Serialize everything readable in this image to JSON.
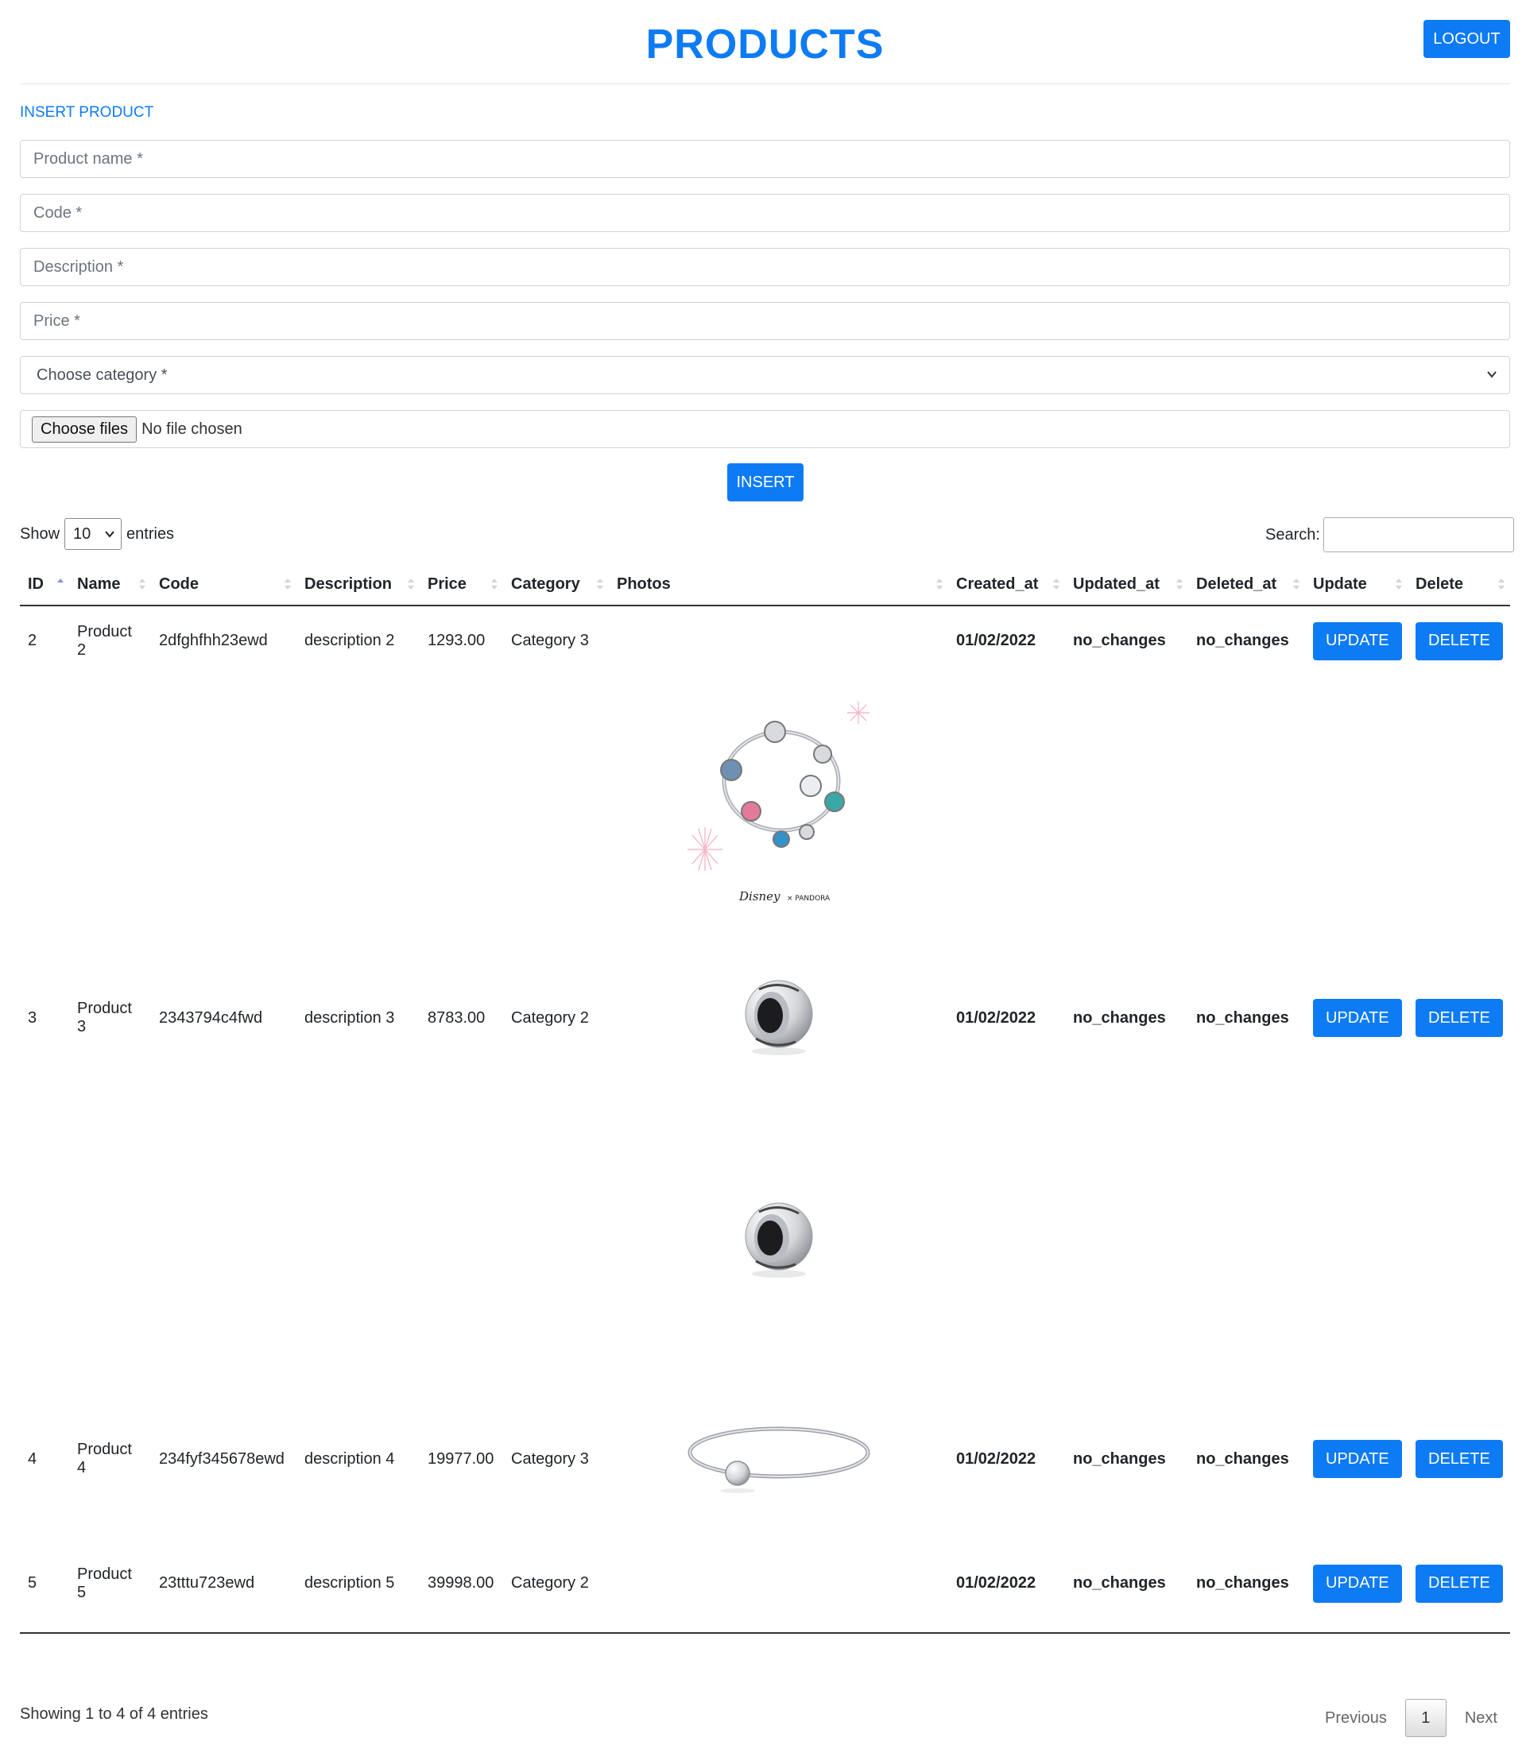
{
  "header": {
    "title": "PRODUCTS",
    "logout_label": "LOGOUT"
  },
  "form": {
    "title": "INSERT PRODUCT",
    "name_placeholder": "Product name *",
    "code_placeholder": "Code *",
    "description_placeholder": "Description *",
    "price_placeholder": "Price *",
    "category_selected": "Choose category *",
    "file_button": "Choose files",
    "file_status": "No file chosen",
    "insert_label": "INSERT"
  },
  "controls": {
    "show_label": "Show",
    "length_value": "10",
    "entries_label": "entries",
    "search_label": "Search:"
  },
  "table": {
    "columns": [
      "ID",
      "Name",
      "Code",
      "Description",
      "Price",
      "Category",
      "Photos",
      "Created_at",
      "Updated_at",
      "Deleted_at",
      "Update",
      "Delete"
    ],
    "rows": [
      {
        "id": "2",
        "name": "Product 2",
        "code": "2dfghfhh23ewd",
        "description": "description 2",
        "price": "1293.00",
        "category": "Category 3",
        "photos": [
          "charm-bracelet-photo"
        ],
        "created_at": "01/02/2022",
        "updated_at": "no_changes",
        "deleted_at": "no_changes",
        "update_label": "UPDATE",
        "delete_label": "DELETE"
      },
      {
        "id": "3",
        "name": "Product 3",
        "code": "2343794c4fwd",
        "description": "description 3",
        "price": "8783.00",
        "category": "Category 2",
        "photos": [
          "clip-charm-photo",
          "clip-charm-photo"
        ],
        "created_at": "01/02/2022",
        "updated_at": "no_changes",
        "deleted_at": "no_changes",
        "update_label": "UPDATE",
        "delete_label": "DELETE"
      },
      {
        "id": "4",
        "name": "Product 4",
        "code": "234fyf345678ewd",
        "description": "description 4",
        "price": "19977.00",
        "category": "Category 3",
        "photos": [
          "bangle-photo"
        ],
        "created_at": "01/02/2022",
        "updated_at": "no_changes",
        "deleted_at": "no_changes",
        "update_label": "UPDATE",
        "delete_label": "DELETE"
      },
      {
        "id": "5",
        "name": "Product 5",
        "code": "23tttu723ewd",
        "description": "description 5",
        "price": "39998.00",
        "category": "Category 2",
        "photos": [],
        "created_at": "01/02/2022",
        "updated_at": "no_changes",
        "deleted_at": "no_changes",
        "update_label": "UPDATE",
        "delete_label": "DELETE"
      }
    ]
  },
  "footer": {
    "info": "Showing 1 to 4 of 4 entries",
    "previous_label": "Previous",
    "current_page": "1",
    "next_label": "Next"
  },
  "colors": {
    "accent": "#0d7bf4",
    "text": "#212529",
    "border": "#ced4da"
  }
}
